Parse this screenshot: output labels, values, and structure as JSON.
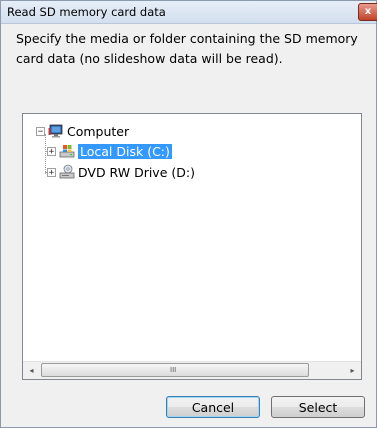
{
  "window": {
    "title": "Read SD memory card data",
    "close_glyph": "x"
  },
  "instructions": "Specify the media or folder containing the SD memory card data (no slideshow data will be read).",
  "tree": {
    "root": {
      "label": "Computer",
      "expander": "−",
      "icon": "computer-icon"
    },
    "children": [
      {
        "label": "Local Disk (C:)",
        "expander": "+",
        "icon": "local-disk-icon",
        "selected": true
      },
      {
        "label": "DVD RW Drive (D:)",
        "expander": "+",
        "icon": "dvd-drive-icon",
        "selected": false
      }
    ]
  },
  "scrollbar": {
    "left_arrow": "◂",
    "right_arrow": "▸",
    "grip": "III"
  },
  "buttons": {
    "cancel_label": "Cancel",
    "select_label": "Select"
  },
  "colors": {
    "selection": "#3399ff",
    "dialog_bg": "#f0f0f0"
  }
}
